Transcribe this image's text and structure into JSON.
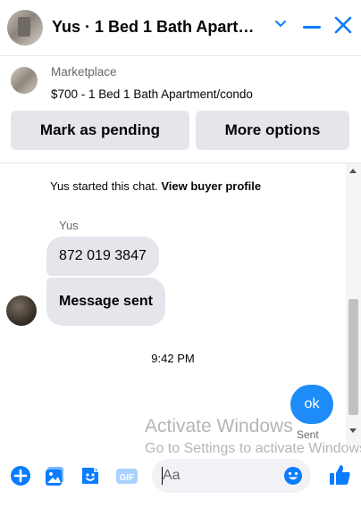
{
  "header": {
    "title": "Yus · 1 Bed 1 Bath Apartme···"
  },
  "listing": {
    "label": "Marketplace",
    "description": "$700 - 1 Bed 1 Bath Apartment/condo",
    "mark_pending_label": "Mark as pending",
    "more_options_label": "More options"
  },
  "chat": {
    "started_text": "Yus started this chat.",
    "view_profile_link": "View buyer profile",
    "sender_name": "Yus",
    "messages": [
      {
        "text": "872 019 3847"
      },
      {
        "text": "Message sent"
      }
    ],
    "timestamp": "9:42 PM",
    "own_message": "ok",
    "own_status": "Sent"
  },
  "composer": {
    "placeholder": "Aa",
    "gif_label": "GIF"
  },
  "watermark": {
    "line1": "Activate Windows",
    "line2": "Go to Settings to activate Windows."
  },
  "colors": {
    "accent": "#0a7cff",
    "bubble_other": "#e4e6eb",
    "bubble_own": "#1d8cf8"
  }
}
